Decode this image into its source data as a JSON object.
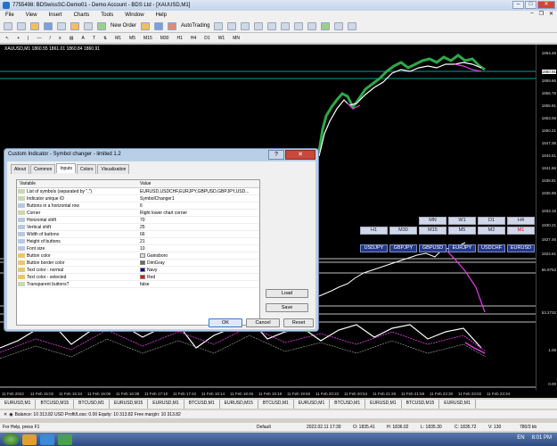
{
  "window": {
    "title": "7755498: BDSwissSC-Demo01 - Demo Account - BDS Ltd - [XAUUSD,M1]"
  },
  "menu": [
    "File",
    "View",
    "Insert",
    "Charts",
    "Tools",
    "Window",
    "Help"
  ],
  "toolbar": {
    "new_order": "New Order",
    "autotrading": "AutoTrading",
    "timeframes": [
      "M1",
      "M5",
      "M15",
      "M30",
      "H1",
      "H4",
      "D1",
      "W1",
      "MN"
    ]
  },
  "chart": {
    "title": "XAUUSD,M1 1860.55 1861.01 1860.84 1860.91",
    "price_labels": [
      "1864.46",
      "1860.91",
      "1859.86",
      "1856.76",
      "1855.91",
      "1853.06",
      "1850.21",
      "1847.36",
      "1844.51",
      "1841.66",
      "1838.81",
      "1835.96",
      "1833.16",
      "1830.21",
      "1827.46",
      "1824.61",
      "66.9753",
      "53.2732",
      "1.05",
      "0.00"
    ],
    "time_labels": [
      "11 Feb 2022",
      "11 Feb 15:02",
      "11 Feb 15:34",
      "11 Feb 16:06",
      "11 Feb 16:38",
      "11 Feb 17:10",
      "11 Feb 17:42",
      "11 Feb 18:14",
      "11 Feb 18:46",
      "11 Feb 19:18",
      "11 Feb 19:50",
      "11 Feb 20:22",
      "11 Feb 20:54",
      "11 Feb 21:26",
      "11 Feb 21:58",
      "11 Feb 22:30",
      "11 Feb 23:02",
      "11 Feb 23:34"
    ],
    "symbol_changer": {
      "timeframe_rows": [
        [
          "MN",
          "W1",
          "D1",
          "H4"
        ],
        [
          "H1",
          "M30",
          "M15",
          "M5",
          "M2",
          "M1"
        ]
      ],
      "selected_timeframe": "M1",
      "symbols": [
        "USDJPY",
        "GBPJPY",
        "GBPUSD",
        "EURJPY",
        "USDCHF",
        "EURUSD"
      ]
    }
  },
  "dialog": {
    "title": "Custom Indicator - Symbol changer - limited 1.2",
    "help": "?",
    "close": "✕",
    "tabs": [
      "About",
      "Common",
      "Inputs",
      "Colors",
      "Visualization"
    ],
    "active_tab": "Inputs",
    "columns": [
      "Variable",
      "Value"
    ],
    "rows": [
      {
        "icon": "abc",
        "variable": "List of symbols (separated by \",\")",
        "value": "EURUSD,USDCHF,EURJPY,GBPUSD,GBPJPY,USD..."
      },
      {
        "icon": "abc",
        "variable": "Indicator unique ID",
        "value": "SymbolChanger1"
      },
      {
        "icon": "123",
        "variable": "Buttons in a horizontal row",
        "value": "6"
      },
      {
        "icon": "abc",
        "variable": "Corner",
        "value": "Right lower chart corner"
      },
      {
        "icon": "123",
        "variable": "Horizontal shift",
        "value": "70"
      },
      {
        "icon": "123",
        "variable": "Vertical shift",
        "value": "25"
      },
      {
        "icon": "123",
        "variable": "Width of buttons",
        "value": "66"
      },
      {
        "icon": "123",
        "variable": "Height of buttons",
        "value": "21"
      },
      {
        "icon": "123",
        "variable": "Font size",
        "value": "10"
      },
      {
        "icon": "clr",
        "variable": "Button color",
        "value": "Gainsboro",
        "color": "#dcdcdc"
      },
      {
        "icon": "clr",
        "variable": "Button border color",
        "value": "DimGray",
        "color": "#696969"
      },
      {
        "icon": "clr",
        "variable": "Text color - normal",
        "value": "Navy",
        "color": "#000080"
      },
      {
        "icon": "clr",
        "variable": "Text color - selected",
        "value": "Red",
        "color": "#ff0000"
      },
      {
        "icon": "abc",
        "variable": "Transparent buttons?",
        "value": "false"
      }
    ],
    "load": "Load",
    "save": "Save",
    "ok": "OK",
    "cancel": "Cancel",
    "reset": "Reset"
  },
  "symbol_tabs": [
    "EURUSD,M1",
    "BTCUSD,M15",
    "BTCUSD,M1",
    "EURUSD,M15",
    "EURUSD,M1",
    "BTCUSD,M1",
    "EURUSD,M15",
    "BTCUSD,M1",
    "EURUSD,M1",
    "BTCUSD,M1",
    "EURUSD,M1",
    "BTCUSD,M15",
    "EURUSD,M1"
  ],
  "balance_line": "Balance: 10 313.82 USD  Profit/Loss: 0.00  Equity: 10 313.82  Free margin: 10 313.82",
  "statusbar": {
    "help": "For Help, press F1",
    "profile": "Default",
    "datetime": "2022.02.11 17:39",
    "o": "O: 1835.41",
    "h": "H: 1836.02",
    "l": "L: 1835.30",
    "c": "C: 1835.72",
    "v": "V: 130",
    "traffic": "780/3 kb"
  },
  "taskbar": {
    "lang": "EN",
    "time": "8:01 PM"
  }
}
